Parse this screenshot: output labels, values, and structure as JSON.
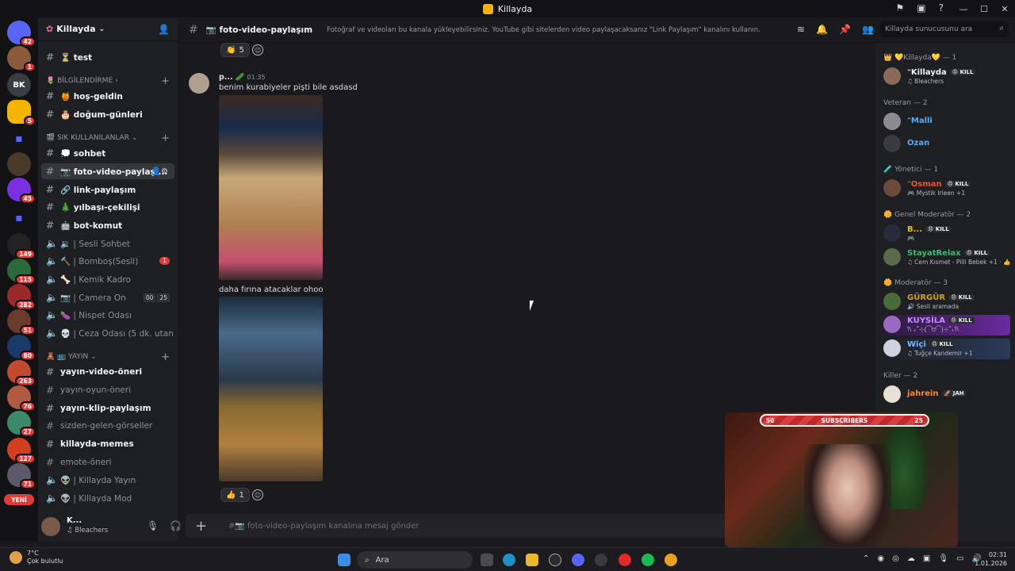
{
  "window": {
    "title": "Killayda",
    "controls": [
      "—",
      "☐",
      "✕"
    ]
  },
  "server": {
    "name": "Killayda"
  },
  "guilds": {
    "badges": [
      "42",
      "1",
      "5",
      "45",
      "149",
      "115",
      "282",
      "51",
      "80",
      "263",
      "76",
      "27",
      "127",
      "71"
    ],
    "abbrev": "BK",
    "new_label": "YENİ"
  },
  "sidebar": {
    "channels": [
      {
        "label": "⏳ test",
        "type": "text",
        "bold": true
      },
      {
        "label": "🍯 hoş-geldin",
        "type": "text",
        "bold": true
      },
      {
        "label": "🎂 doğum-günleri",
        "type": "text",
        "bold": true
      },
      {
        "label": "💭 sohbet",
        "type": "text",
        "bold": true
      },
      {
        "label": "📷 foto-video-paylaşı...",
        "type": "text",
        "bold": true,
        "selected": true
      },
      {
        "label": "🔗 link-paylaşım",
        "type": "text",
        "bold": true
      },
      {
        "label": "🎄 yılbaşı-çekilişi",
        "type": "text",
        "bold": true
      },
      {
        "label": "🤖 bot-komut",
        "type": "text",
        "bold": true
      },
      {
        "label": "🔉 | Sesli Sohbet",
        "type": "voice"
      },
      {
        "label": "🔨 | Bomboş(Sesli)",
        "type": "voice",
        "badge": "1"
      },
      {
        "label": "🦴 | Kemik Kadro",
        "type": "voice"
      },
      {
        "label": "📷 | Camera On",
        "type": "voice",
        "counts": [
          "00",
          "25"
        ]
      },
      {
        "label": "🍆 | Nispet Odası",
        "type": "voice"
      },
      {
        "label": "💀 | Ceza Odası (5 dk. utan...",
        "type": "voice"
      },
      {
        "label": "yayın-video-öneri",
        "type": "text",
        "bold": true
      },
      {
        "label": "yayın-oyun-öneri",
        "type": "text"
      },
      {
        "label": "yayın-klip-paylaşım",
        "type": "text",
        "bold": true
      },
      {
        "label": "sizden-gelen-görseller",
        "type": "text"
      },
      {
        "label": "killayda-memes",
        "type": "text",
        "bold": true
      },
      {
        "label": "emote-öneri",
        "type": "text"
      },
      {
        "label": "👽 | Killayda Yayın",
        "type": "voice"
      },
      {
        "label": "👽 | Killayda Mod",
        "type": "voice"
      }
    ],
    "categories": [
      "🌷 BİLGİLENDİRME",
      "🎬 SIK KULLANILANLAR",
      "🧸 📺 YAYIN"
    ]
  },
  "user": {
    "name": "K...",
    "status": "♫ Bleachers"
  },
  "channel": {
    "name": "📷 foto-video-paylaşım",
    "topic": "Fotoğraf ve videoları bu kanala yükleyebilirsiniz. YouTube gibi sitelerden video paylaşacaksanız \"Link Paylaşım\" kanalını kullanın.",
    "search_placeholder": "Killayda sunucusunu ara",
    "composer_placeholder": "#📷 foto-video-paylaşım kanalına mesaj gönder"
  },
  "messages": [
    {
      "reaction": "👏",
      "count": "5"
    },
    {
      "author": "p...",
      "time": "01:35",
      "text": "benim kurabiyeler pişti bile asdasd"
    },
    {
      "text": "daha fırına atacaklar ohoo"
    },
    {
      "reaction": "👍",
      "count": "1"
    }
  ],
  "members": {
    "groups": [
      {
        "title": "👑 💛Killayda💛 — 1",
        "members": [
          {
            "name": "ᵔKillayda",
            "activity": "♫ Bleachers",
            "color": "#f2f3f5",
            "tag": "😠 KILL"
          }
        ]
      },
      {
        "title": "Veteran — 2",
        "members": [
          {
            "name": "ᵔMalli",
            "activity": "",
            "color": "#5ca9f4"
          },
          {
            "name": "Ozan",
            "activity": "",
            "color": "#5ca9f4"
          }
        ]
      },
      {
        "title": "🧪 Yönetici — 1",
        "members": [
          {
            "name": "ᵔOsman",
            "activity": "🎮 Mystik Irieen +1",
            "color": "#e05a3a",
            "tag": "😠 KILL"
          }
        ]
      },
      {
        "title": "🌼 Genel Moderatör — 2",
        "members": [
          {
            "name": "B...",
            "activity": "🎮",
            "color": "#f0c000",
            "tag": "😠 KILL"
          },
          {
            "name": "StayatRelax",
            "activity": "♫ Cem Kısmet - Pilli Bebek +1 · 👍",
            "color": "#2ec46a",
            "tag": "😠 KILL"
          }
        ]
      },
      {
        "title": "🌼 Moderatör — 3",
        "members": [
          {
            "name": "GÜRGÜR",
            "activity": "🔊 Sesli aramada",
            "color": "#d4a017",
            "tag": "😠 KILL"
          },
          {
            "name": "KUYSİLA",
            "activity": "𐙚 ₊˚⊹(⁀ᗢ⁀)⊹˚₊𐙚",
            "color": "#c78bff",
            "tag": "😠 KILL"
          },
          {
            "name": "Wiçi",
            "activity": "♫ Tuğçe Kandemir +1",
            "color": "#7ab8ff",
            "tag": "😠 KILL"
          }
        ]
      },
      {
        "title": "Killer — 2",
        "members": [
          {
            "name": "jahrein",
            "activity": "",
            "color": "#f08c38",
            "tag": "🚀 JAH"
          }
        ]
      }
    ]
  },
  "overlay": {
    "left": "50",
    "label": "SUBSCRIBERS",
    "right": "25"
  },
  "taskbar": {
    "temp": "7°C",
    "weather": "Çok bulutlu",
    "search": "Ara",
    "time": "02:31",
    "date": "1.01.2026"
  }
}
